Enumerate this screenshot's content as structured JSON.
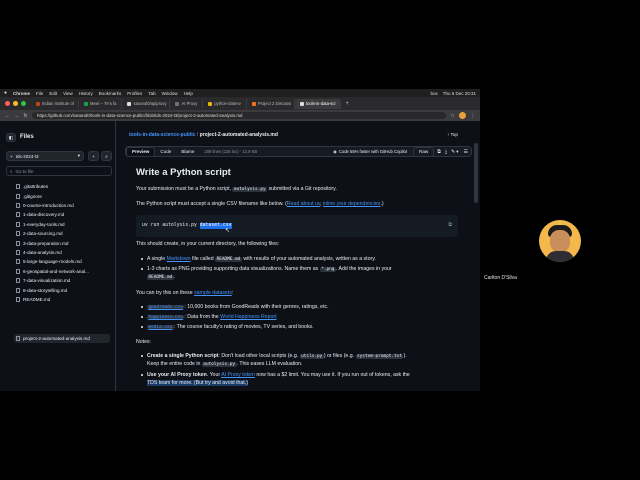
{
  "menubar": {
    "apple": "",
    "items": [
      "Chrome",
      "File",
      "Edit",
      "View",
      "History",
      "Bookmarks",
      "Profiles",
      "Tab",
      "Window",
      "Help"
    ],
    "right": [
      "box",
      "Thu 5 Dec  20:31"
    ]
  },
  "tabs": [
    "Indian Institute of",
    "Meet – TA's fa",
    "sanand0/apiproxy",
    "AI Proxy",
    "python-dotenv",
    "Project 2 Discussi",
    "tools-in-data-sci"
  ],
  "address": {
    "url": "https://github.com/sanand0/tools-in-data-science-public/blob/tds-2024-t3/project-2-automated-analysis.md"
  },
  "sidebar": {
    "title": "Files",
    "branch": "tds-2024-t3",
    "add": "+",
    "search_placeholder": "Go to file",
    "files": [
      ".gitattributes",
      ".gitignore",
      "0-course-introduction.md",
      "1-data-discovery.md",
      "1-everyday-tools.md",
      "2-data-sourcing.md",
      "3-data-preparation.md",
      "4-data-analysis.md",
      "5-large-language-models.md",
      "6-geospatial-and-network-anal...",
      "7-data-visualization.md",
      "8-data-storytelling.md",
      "README.md",
      "project-2-automated-analysis.md"
    ]
  },
  "content": {
    "crumb_repo": "tools-in-data-science-public",
    "crumb_sep": " / ",
    "crumb_file": "project-2-automated-analysis.md",
    "top": "Top",
    "tabs": [
      "Preview",
      "Code",
      "Blame"
    ],
    "stats": "209 lines (135 loc) · 12.9 KB",
    "copilot": "Code 55% faster with GitHub Copilot",
    "raw": "Raw"
  },
  "doc": {
    "h1": "Write a Python script",
    "p1a": "Your submission must be a Python script, ",
    "p1code": "autolysis.py",
    "p1b": " submitted via a Git repository.",
    "p2a": "The Python script must accept a single CSV filename like below. (",
    "p2link1": "Read about uv",
    "p2sep": ", ",
    "p2link2": "inline your dependencies",
    "p2b": ".)",
    "cmd": "uv run autolysis.py ",
    "cmdarg": "dataset.csv",
    "p3": "This should create, in your current directory, the following files:",
    "b1a": "A single ",
    "b1link": "Markdown",
    "b1b": " file called ",
    "b1code": "README.md",
    "b1c": " with results of your automated analysis, written as a story.",
    "b2a": "1-3 charts as PNG providing supporting data visualizations. Name them as ",
    "b2code": "*.png",
    "b2b": ". Add the images in your",
    "b2code2": "README.md",
    "b2c": ".",
    "p4a": "You can try this on these ",
    "p4link": "sample datasets",
    "p4b": ":",
    "d1code": "goodreads.csv",
    "d1": ": 10,000 books from GoodReads with their genres, ratings, etc.",
    "d2code": "happiness.csv",
    "d2a": ": Data from the ",
    "d2link": "World Happiness Report",
    "d3code": "media.csv",
    "d3": ": The course faculty's rating of movies, TV series, and books.",
    "notes": "Notes:",
    "n1bold": "Create a single Python script",
    "n1a": ": Don't load other local scripts (e.g. ",
    "n1code1": "utils.py",
    "n1b": ") or files (e.g. ",
    "n1code2": "system-prompt.txt",
    "n1c": ").",
    "n1d": "Keep the entire code in ",
    "n1code3": "autolysis.py",
    "n1e": ". This eases LLM evaluation.",
    "n2bold": "Use your AI Proxy token",
    "n2a": ". Your ",
    "n2link": "AI Proxy token",
    "n2b": " now has a $2 limit. You may use it. If you run out of tokens, ask the",
    "n2c": "TDS team for more. (But try and avoid that.)"
  },
  "participant": {
    "name": "Carlton D'Silva"
  },
  "colors": {
    "accent": "#4493f8",
    "bg": "#0d1117",
    "border": "#30363d",
    "highlight": "#1f6feb"
  }
}
